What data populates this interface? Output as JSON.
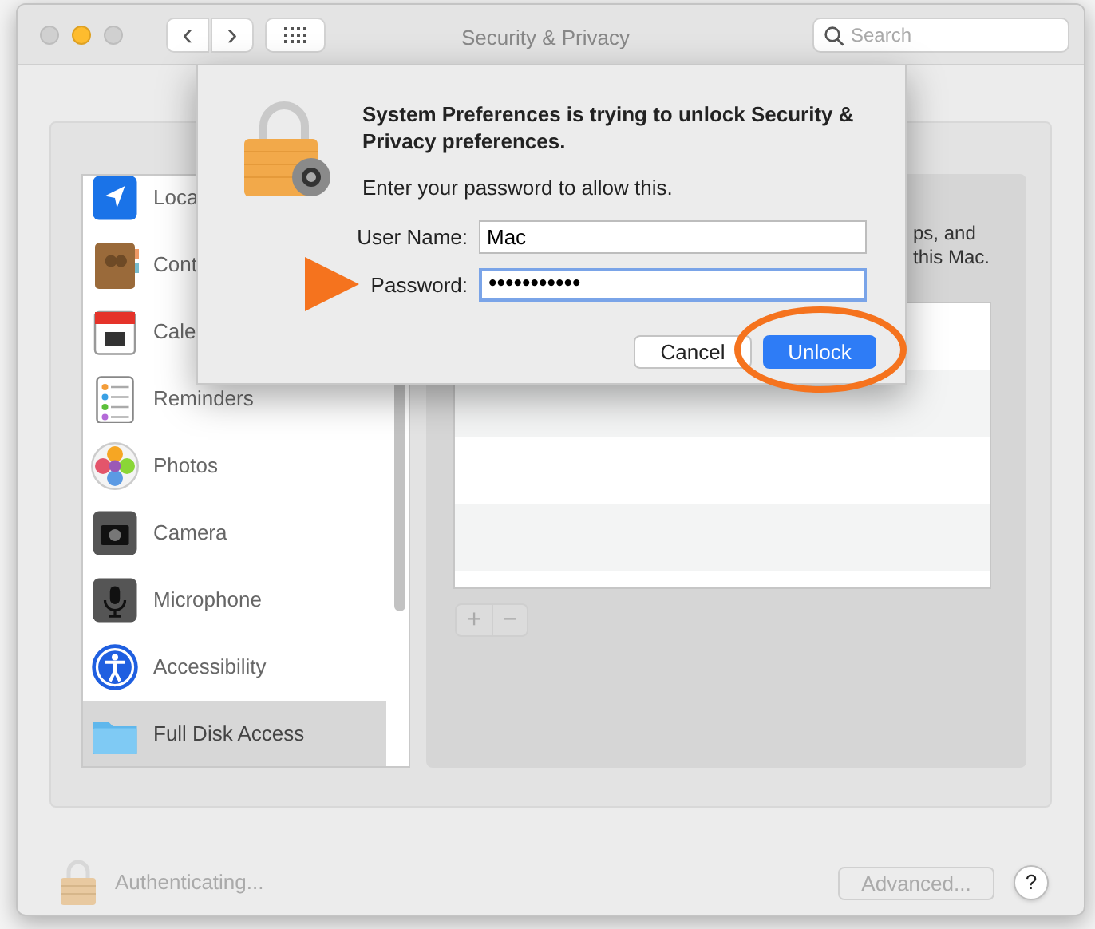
{
  "window": {
    "title": "Security & Privacy",
    "traffic_lights": [
      {
        "kind": "close",
        "enabled": false
      },
      {
        "kind": "minimize",
        "enabled": true
      },
      {
        "kind": "zoom",
        "enabled": false
      }
    ]
  },
  "toolbar": {
    "back": "‹",
    "forward": "›",
    "search": {
      "placeholder": "Search"
    }
  },
  "sidebar": {
    "items": [
      {
        "kind": "location",
        "label": "Loca",
        "selected": false
      },
      {
        "kind": "contacts",
        "label": "Cont",
        "selected": false
      },
      {
        "kind": "calendar",
        "label": "Cale",
        "selected": false
      },
      {
        "kind": "reminders",
        "label": "Reminders",
        "selected": false
      },
      {
        "kind": "photos",
        "label": "Photos",
        "selected": false
      },
      {
        "kind": "camera",
        "label": "Camera",
        "selected": false
      },
      {
        "kind": "microphone",
        "label": "Microphone",
        "selected": false
      },
      {
        "kind": "accessibility",
        "label": "Accessibility",
        "selected": false
      },
      {
        "kind": "folder",
        "label": "Full Disk Access",
        "selected": true
      }
    ]
  },
  "detail": {
    "description_lines": [
      "ps, and",
      "this Mac."
    ],
    "buttons": [
      {
        "label": "+",
        "disabled": true
      },
      {
        "label": "−",
        "disabled": true
      }
    ]
  },
  "footer": {
    "status": "Authenticating...",
    "advanced": {
      "label": "Advanced...",
      "disabled": true
    },
    "help": "?"
  },
  "dialog": {
    "title": "System Preferences is trying to unlock Security & Privacy preferences.",
    "message": "Enter your password to allow this.",
    "fields": [
      {
        "label": "User Name:",
        "value": "Mac",
        "focused": false
      },
      {
        "label": "Password:",
        "value": "•••••••••••",
        "focused": true
      }
    ],
    "buttons": [
      {
        "label": "Cancel",
        "default": false
      },
      {
        "label": "Unlock",
        "default": true
      }
    ]
  },
  "annotations": [
    {
      "kind": "arrow"
    },
    {
      "kind": "ellipse"
    }
  ]
}
